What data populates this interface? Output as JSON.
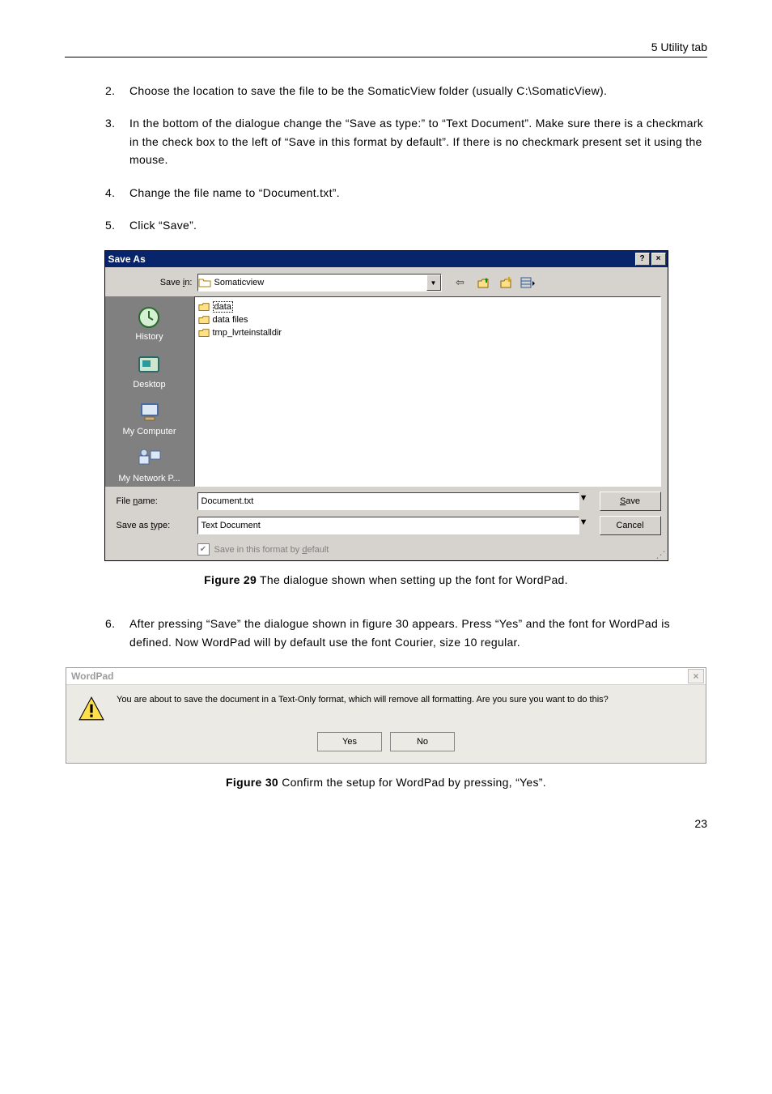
{
  "header": {
    "section": "5 Utility tab"
  },
  "steps_a": [
    {
      "n": "2.",
      "t": "Choose the location to save the file to be the SomaticView folder (usually C:\\SomaticView)."
    },
    {
      "n": "3.",
      "t": "In the bottom of the dialogue change the “Save as type:” to “Text Document”. Make sure there is a checkmark in the check box to the left of “Save in this format by default”. If there is no checkmark present set it using the mouse."
    },
    {
      "n": "4.",
      "t": "Change the file name to “Document.txt”."
    },
    {
      "n": "5.",
      "t": "Click “Save”."
    }
  ],
  "saveas": {
    "title": "Save As",
    "help_btn": "?",
    "close_btn": "×",
    "savein_label": "Save in:",
    "savein_value": "Somaticview",
    "places": [
      "History",
      "Desktop",
      "My Computer",
      "My Network P..."
    ],
    "files": [
      "data",
      "data files",
      "tmp_lvrteinstalldir"
    ],
    "filename_label": "File name:",
    "filename_value": "Document.txt",
    "saveastype_label": "Save as type:",
    "saveastype_value": "Text Document",
    "save_btn": "Save",
    "cancel_btn": "Cancel",
    "chk_label": "Save in this format by default"
  },
  "caption29": {
    "b": "Figure 29",
    "t": " The dialogue shown when setting up the font for WordPad."
  },
  "steps_b": [
    {
      "n": "6.",
      "t": "After pressing “Save” the dialogue shown in figure 30 appears. Press “Yes” and the font for WordPad is defined. Now WordPad will by default use the font Courier, size 10 regular."
    }
  ],
  "msgbox": {
    "title": "WordPad",
    "close": "×",
    "text": "You are about to save the document in a Text-Only format, which will remove all formatting. Are you sure you want to do this?",
    "yes": "Yes",
    "no": "No"
  },
  "caption30": {
    "b": "Figure 30",
    "t": " Confirm the setup for WordPad by pressing, “Yes”."
  },
  "page_number": "23"
}
